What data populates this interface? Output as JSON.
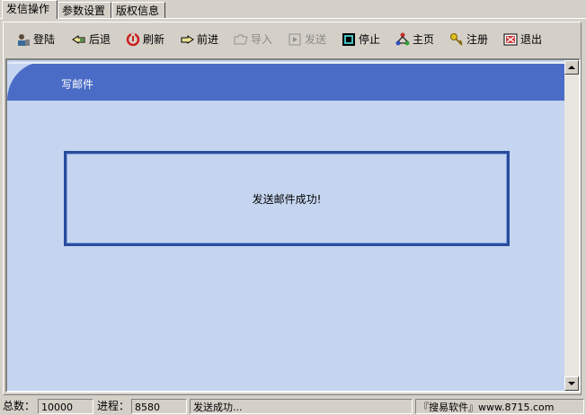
{
  "tabs": [
    "发信操作",
    "参数设置",
    "版权信息"
  ],
  "toolbar": {
    "login": "登陆",
    "back": "后退",
    "refresh": "刷新",
    "forward": "前进",
    "import": "导入",
    "send": "发送",
    "stop": "停止",
    "home": "主页",
    "register": "注册",
    "exit": "退出"
  },
  "header": {
    "title": "写邮件"
  },
  "message": "发送邮件成功!",
  "status": {
    "total_label": "总数：",
    "total_value": "10000",
    "progress_label": "进程：",
    "progress_value": "8580",
    "message": "发送成功...",
    "brand": "『搜易软件』www.8715.com"
  },
  "colors": {
    "header": "#4a6bc6",
    "view_bg": "#c5d5f0",
    "msg_border": "#2a4c9c"
  }
}
